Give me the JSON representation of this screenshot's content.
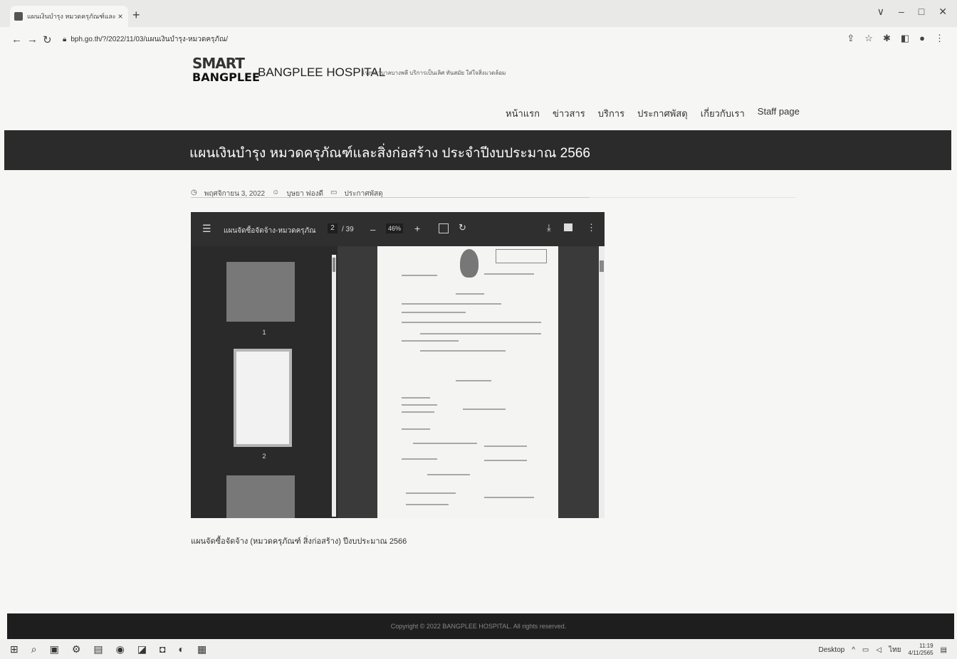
{
  "browser": {
    "tab_title": "แผนเงินบำรุง หมวดครุภัณฑ์และสิ่งก่อ...",
    "tab_close": "×",
    "new_tab": "+",
    "url": "bph.go.th/?/2022/11/03/แผนเงินบำรุง-หมวดครุภัณ/",
    "window_controls": [
      "∨",
      "–",
      "□",
      "✕"
    ],
    "toolbar_icons": [
      "share-icon",
      "star-icon",
      "extensions-icon",
      "sidebar-icon",
      "profile-icon",
      "menu-icon"
    ]
  },
  "site": {
    "logo_line1": "SMART",
    "logo_line2": "BANGPLEE",
    "name": "BANGPLEE HOSPITAL",
    "tagline": "โรงพยาบาลบางพลี บริการเป็นเลิศ ทันสมัย ใส่ใจสิ่งแวดล้อม",
    "menu": [
      "หน้าแรก",
      "ข่าวสาร",
      "บริการ",
      "ประกาศพัสดุ",
      "เกี่ยวกับเรา",
      "Staff page"
    ]
  },
  "post": {
    "title": "แผนเงินบำรุง หมวดครุภัณฑ์และสิ่งก่อสร้าง ประจำปีงบประมาณ 2566",
    "date": "พฤศจิกายน 3, 2022",
    "author": "บุษยา ฟองดี",
    "category": "ประกาศพัสดุ",
    "caption": "แผนจัดซื้อจัดจ้าง (หมวดครุภัณฑ์ สิ่งก่อสร้าง) ปีงบประมาณ 2566"
  },
  "pdf_viewer": {
    "file_name": "แผนจัดซื้อจัดจ้าง-หมวดครุภัณ...",
    "current_page": "2",
    "total_pages": "/ 39",
    "zoom": "46%",
    "thumbnail_labels": [
      "1",
      "2"
    ]
  },
  "footer": {
    "copyright": "Copyright © 2022 BANGPLEE HOSPITAL. All rights reserved."
  },
  "taskbar": {
    "desktop_label": "Desktop",
    "lang": "ไทย",
    "time": "11:19",
    "date": "4/11/2565"
  }
}
